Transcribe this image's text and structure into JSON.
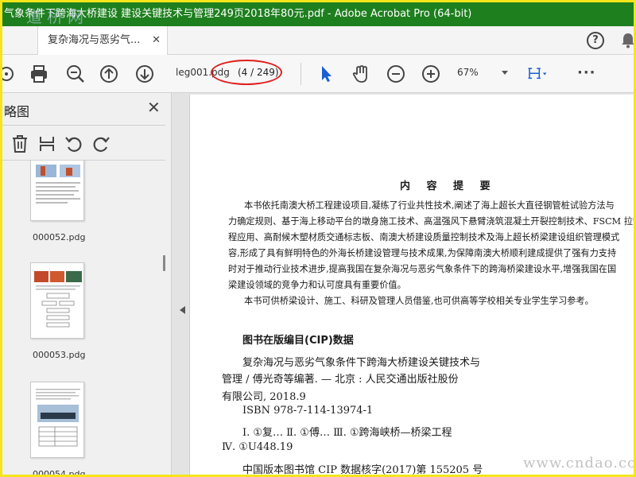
{
  "window": {
    "title": "气象条件下跨海大桥建设 建设关键技术与管理249页2018年80元.pdf - Adobe Acrobat Pro (64-bit)",
    "watermark_top": "道桥网"
  },
  "tabs": [
    {
      "label": "复杂海况与恶劣气...",
      "close": "✕"
    }
  ],
  "toolbar": {
    "page_name": "leg001.pdg",
    "page_indicator": "(4 / 249)",
    "zoom": "67%",
    "more": "···"
  },
  "left_panel": {
    "title": "略图",
    "close": "✕",
    "thumbnails": [
      {
        "label": "000052.pdg"
      },
      {
        "label": "000053.pdg"
      },
      {
        "label": "000054.pdg"
      }
    ]
  },
  "document": {
    "heading": "内 容 提 要",
    "summary_lines": [
      "本书依托南澳大桥工程建设项目,凝练了行业共性技术,阐述了海上超长大直径钢管桩试验方法与",
      "力确定规则、基于海上移动平台的墩身施工技术、高温强风下悬臂浇筑混凝土开裂控制技术、FSCM 拉索",
      "程应用、高耐候木塑材质交通标志板、南澳大桥建设质量控制技术及海上超长桥梁建设组织管理模式",
      "容,形成了具有鲜明特色的外海长桥建设管理与技术成果,为保障南澳大桥顺利建成提供了强有力支持",
      "时对于推动行业技术进步,提高我国在复杂海况与恶劣气象条件下的跨海桥梁建设水平,增强我国在国",
      "梁建设领域的竞争力和认可度具有重要价值。",
      "本书可供桥梁设计、施工、科研及管理人员借鉴,也可供高等学校相关专业学生学习参考。"
    ],
    "cip_title": "图书在版编目(CIP)数据",
    "cip_lines": [
      "复杂海况与恶劣气象条件下跨海大桥建设关键技术与",
      "管理 / 傅光奇等编著. — 北京 : 人民交通出版社股份",
      "有限公司, 2018.9",
      "ISBN  978-7-114-13974-1",
      "Ⅰ. ①复… Ⅱ. ①傅… Ⅲ. ①跨海峡桥—桥梁工程",
      "Ⅳ. ①U448.19",
      "中国版本图书馆 CIP 数据核字(2017)第 155205 号"
    ],
    "watermark_bottom": "www.cndao.com"
  },
  "colors": {
    "titlebar": "#1e7f1e",
    "frame": "#f5e51b",
    "accent_blue": "#1a5fd0",
    "annotation_red": "#e0201e"
  }
}
